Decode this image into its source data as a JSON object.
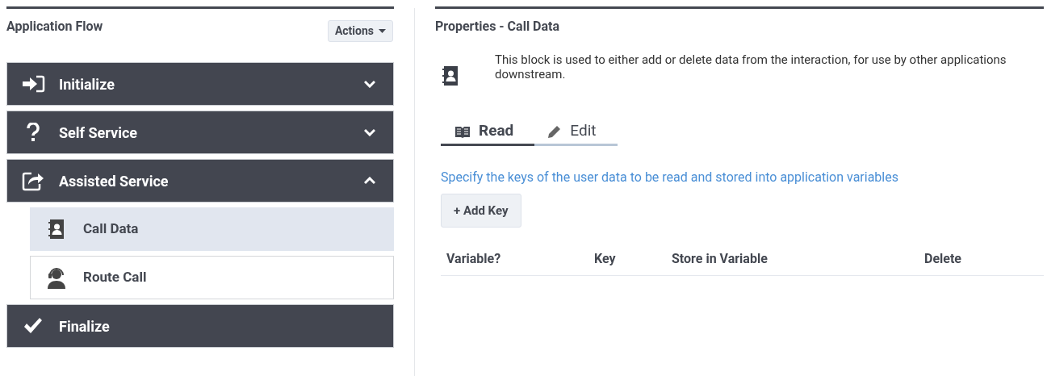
{
  "flow": {
    "title": "Application Flow",
    "actions_button": "Actions",
    "sections": [
      {
        "label": "Initialize",
        "expanded": false
      },
      {
        "label": "Self Service",
        "expanded": false
      },
      {
        "label": "Assisted Service",
        "expanded": true,
        "children": [
          {
            "label": "Call Data",
            "selected": true
          },
          {
            "label": "Route Call",
            "selected": false
          }
        ]
      },
      {
        "label": "Finalize"
      }
    ]
  },
  "properties": {
    "title": "Properties - Call Data",
    "description": "This block is used to either add or delete data from the interaction, for use by other applications downstream.",
    "tabs": [
      {
        "label": "Read",
        "selected": true
      },
      {
        "label": "Edit",
        "selected": false
      }
    ],
    "hint": "Specify the keys of the user data to be read and stored into application variables",
    "add_button": "+ Add Key",
    "table": {
      "columns": [
        "Variable?",
        "Key",
        "Store in Variable",
        "Delete"
      ]
    }
  }
}
